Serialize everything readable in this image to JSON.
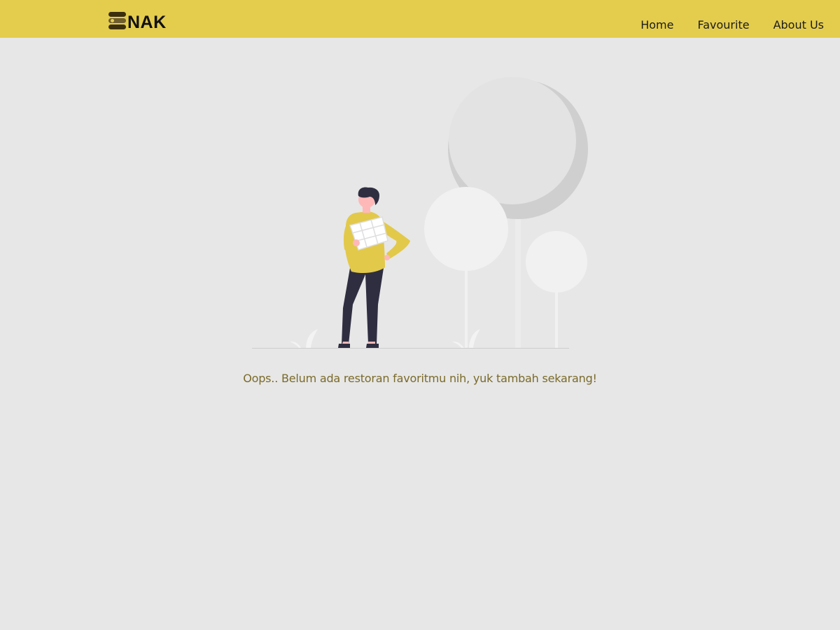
{
  "header": {
    "brand": {
      "text": "NAK",
      "icon": "burger-stack-icon"
    },
    "nav": [
      {
        "label": "Home"
      },
      {
        "label": "Favourite"
      },
      {
        "label": "About Us"
      }
    ]
  },
  "main": {
    "illustration": "empty-favourites-illustration",
    "message": "Oops.. Belum ada restoran favoritmu nih, yuk tambah sekarang!"
  },
  "colors": {
    "header_bg": "#e4cd4d",
    "page_bg": "#e7e7e7",
    "message_text": "#7a6a2a",
    "accent_yellow": "#e2c94a",
    "pants": "#2f2e41"
  }
}
